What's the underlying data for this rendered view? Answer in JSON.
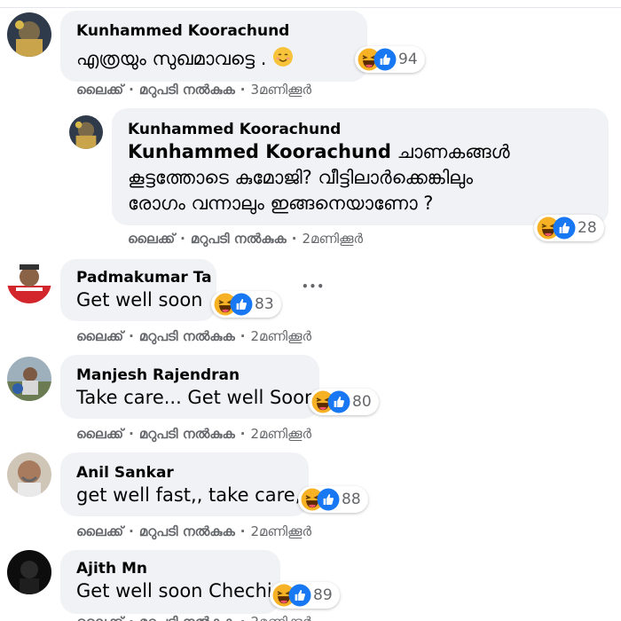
{
  "comments": [
    {
      "author": "Kunhammed Koorachund",
      "text": "എത്രയും സുഖമാവട്ടെ .",
      "reaction_count": "94",
      "actions": {
        "like": "ലൈക്ക്",
        "reply": "മറുപടി നൽകുക",
        "time": "3മണിക്കൂർ"
      }
    },
    {
      "author": "Kunhammed Koorachund",
      "text_author": "Kunhammed Koorachund",
      "text_line1": " ചാണകങ്ങൾ",
      "text_line2": "കൂട്ടത്തോടെ കുമോജി? വീട്ടിലാർക്കെങ്കിലും",
      "text_line3": "രോഗം വന്നാലും ഇങ്ങനെയാണോ ?",
      "reaction_count": "28",
      "actions": {
        "like": "ലൈക്ക്",
        "reply": "മറുപടി നൽകുക",
        "time": "2മണിക്കൂർ"
      }
    },
    {
      "author": "Padmakumar Ta",
      "text": "Get well soon",
      "reaction_count": "83",
      "actions": {
        "like": "ലൈക്ക്",
        "reply": "മറുപടി നൽകുക",
        "time": "2മണിക്കൂർ"
      }
    },
    {
      "author": "Manjesh Rajendran",
      "text": "Take care... Get well Soon",
      "reaction_count": "80",
      "actions": {
        "like": "ലൈക്ക്",
        "reply": "മറുപടി നൽകുക",
        "time": "2മണിക്കൂർ"
      }
    },
    {
      "author": "Anil Sankar",
      "text": "get well fast,, take care,,,",
      "reaction_count": "88",
      "actions": {
        "like": "ലൈക്ക്",
        "reply": "മറുപടി നൽകുക",
        "time": "2മണിക്കൂർ"
      }
    },
    {
      "author": "Ajith Mn",
      "text": "Get well soon Chechi",
      "reaction_count": "89",
      "actions": {
        "like": "ലൈക്ക്",
        "reply": "മറുപടി നൽകുക",
        "time": "2മണിക്കൂർ"
      }
    }
  ],
  "more_label": "•••",
  "icons": {
    "haha": "haha-reaction-icon",
    "like": "like-reaction-icon",
    "smile": "smiling-face-emoji",
    "more": "more-options-icon"
  },
  "colors": {
    "bubble": "#f0f2f5",
    "meta": "#65676b",
    "haha": "#f7b125",
    "like": "#1877f2"
  }
}
